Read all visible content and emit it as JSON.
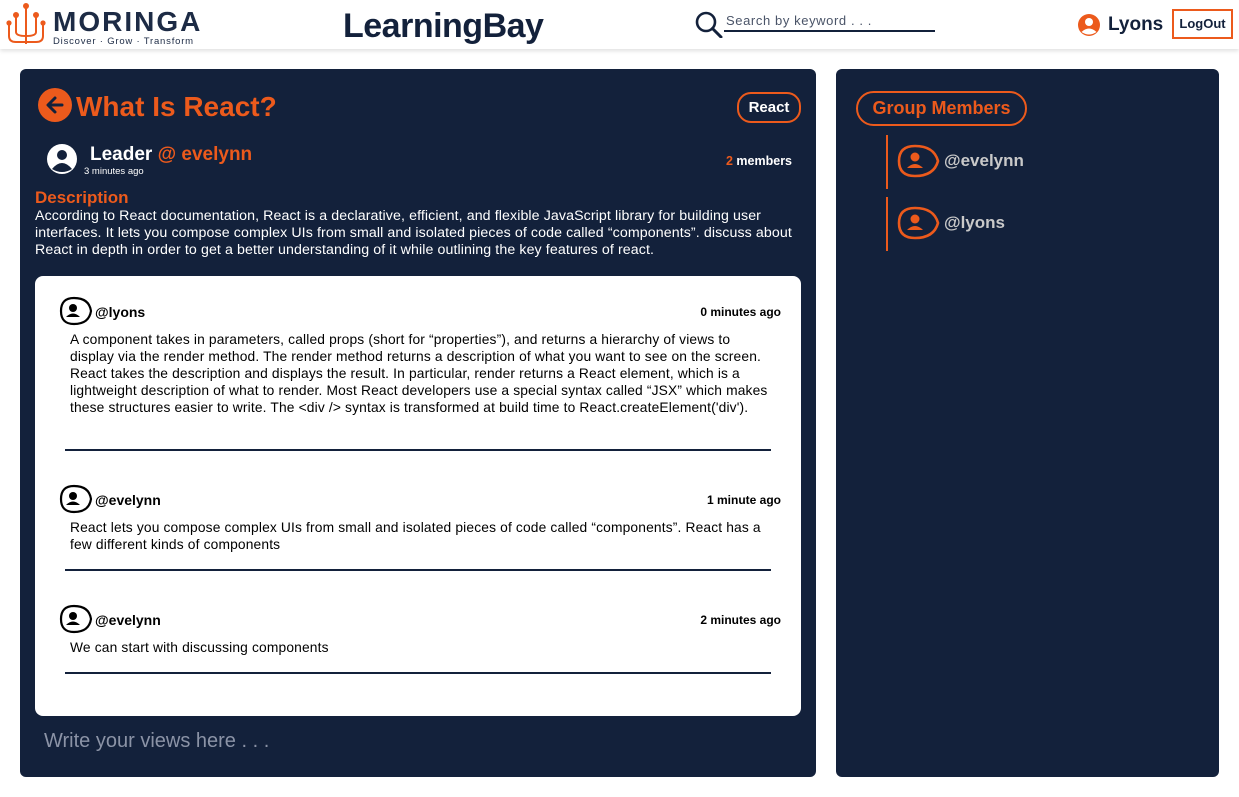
{
  "header": {
    "logo_word": "MORINGA",
    "logo_tagline": "Discover · Grow · Transform",
    "brand": "LearningBay",
    "search_placeholder": "Search by keyword . . .",
    "username": "Lyons",
    "logout_label": "LogOut"
  },
  "topic": {
    "title": "What Is React?",
    "tag": "React",
    "leader_label": "Leader ",
    "leader_handle": "@ evelynn",
    "posted_time": "3 minutes ago",
    "members_count": "2",
    "members_label": " members",
    "description_heading": "Description",
    "description": "According to React documentation, React is a declarative, efficient, and flexible JavaScript library for building user interfaces. It lets you compose complex UIs from small and isolated pieces of code called “components”. discuss about React in depth in order to get a better understanding of it while outlining the key features of react."
  },
  "comments": [
    {
      "user": "@lyons",
      "time": "0 minutes ago",
      "text": "A component takes in parameters, called props (short for “properties”), and returns a hierarchy of views to display via the render method. The render method returns a description of what you want to see on the screen. React takes the description and displays the result. In particular, render returns a React element, which is a lightweight description of what to render. Most React developers use a special syntax called “JSX” which makes these structures easier to write. The <div /> syntax is transformed at build time to React.createElement('div')."
    },
    {
      "user": "@evelynn",
      "time": "1 minute ago",
      "text": "React lets you compose complex UIs from small and isolated pieces of code called “components”. React has a few different kinds of components"
    },
    {
      "user": "@evelynn",
      "time": "2 minutes ago",
      "text": "We can start with discussing components"
    }
  ],
  "composer": {
    "placeholder": "Write your views here . . ."
  },
  "sidebar": {
    "heading": "Group Members",
    "members": [
      {
        "handle": "@evelynn"
      },
      {
        "handle": "@lyons"
      }
    ]
  },
  "icons": {
    "search": "search-icon",
    "user": "user-icon",
    "back": "arrow-left-icon",
    "avatar": "avatar-icon"
  },
  "colors": {
    "navy": "#13213b",
    "accent": "#ec5a1c",
    "white": "#ffffff"
  }
}
